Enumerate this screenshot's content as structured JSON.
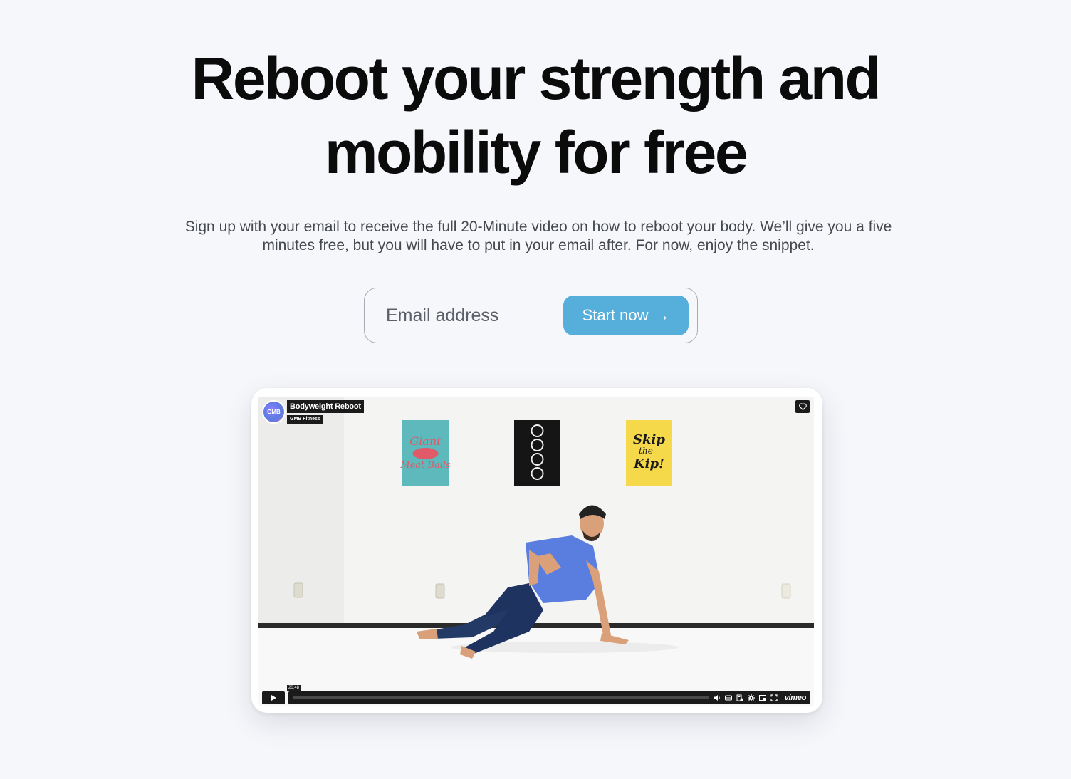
{
  "hero": {
    "title_line1": "Reboot your strength and",
    "title_line2": "mobility for free",
    "description": "Sign up with your email to receive the full 20-Minute video on how to reboot your body. We’ll give you a five minutes free, but you will have to put in your email after. For now, enjoy the snippet."
  },
  "signup": {
    "email_placeholder": "Email address",
    "email_value": "",
    "button_label": "Start now",
    "button_arrow": "→"
  },
  "video": {
    "title": "Bodyweight Reboot",
    "channel": "GMB Fitness",
    "avatar_text": "GMB",
    "duration": "20:48",
    "brand": "vimeo",
    "posters": [
      "Giant Meat Balls",
      "Skip the Kip!"
    ],
    "icons": [
      "play-icon",
      "heart-icon",
      "volume-icon",
      "captions-icon",
      "chapters-icon",
      "settings-icon",
      "pip-icon",
      "fullscreen-icon"
    ]
  },
  "colors": {
    "page_background": "#f6f7fb",
    "accent": "#56aedb",
    "headline": "#0b0b0c",
    "body_text": "#45484f"
  }
}
